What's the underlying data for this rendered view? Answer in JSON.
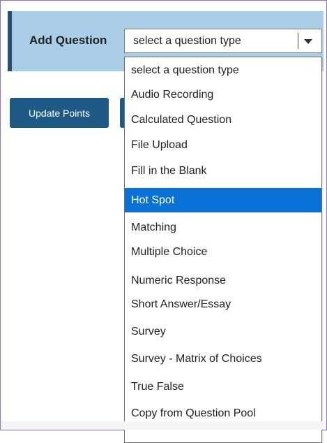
{
  "add_question": {
    "label": "Add Question",
    "select_value": "select a question type"
  },
  "buttons": {
    "update_points": "Update Points"
  },
  "dropdown": {
    "options": [
      "select a question type",
      "Audio Recording",
      "Calculated Question",
      "File Upload",
      "Fill in the Blank",
      "Hot Spot",
      "Matching",
      "Multiple Choice",
      "Numeric Response",
      "Short Answer/Essay",
      "Survey",
      "Survey - Matrix of Choices",
      "True False",
      "Copy from Question Pool"
    ],
    "highlighted_option": "Hot Spot"
  },
  "colors": {
    "header_bg": "#a9cde6",
    "header_accent": "#2a4e6e",
    "button_bg": "#1f5a86",
    "highlight": "#0a72d6",
    "frame_border": "#8f6fc6"
  }
}
